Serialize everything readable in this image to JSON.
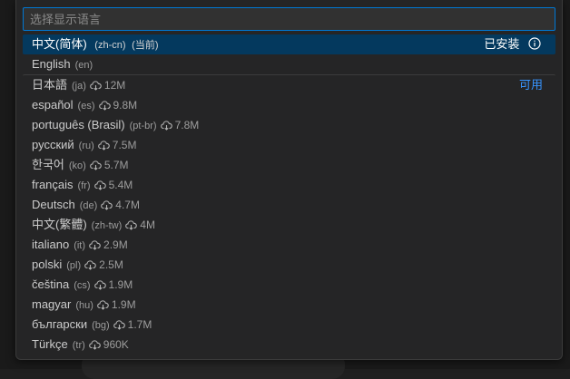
{
  "search": {
    "placeholder": "选择显示语言"
  },
  "selected_language": {
    "name": "中文(简体)",
    "code": "(zh-cn)",
    "tag": "(当前)",
    "status": "已安装",
    "icon": "info-icon"
  },
  "installed_languages": [
    {
      "name": "English",
      "code": "(en)"
    }
  ],
  "available_label": "可用",
  "available_languages": [
    {
      "name": "日本語",
      "code": "(ja)",
      "size": "12M"
    },
    {
      "name": "español",
      "code": "(es)",
      "size": "9.8M"
    },
    {
      "name": "português (Brasil)",
      "code": "(pt-br)",
      "size": "7.8M"
    },
    {
      "name": "русский",
      "code": "(ru)",
      "size": "7.5M"
    },
    {
      "name": "한국어",
      "code": "(ko)",
      "size": "5.7M"
    },
    {
      "name": "français",
      "code": "(fr)",
      "size": "5.4M"
    },
    {
      "name": "Deutsch",
      "code": "(de)",
      "size": "4.7M"
    },
    {
      "name": "中文(繁體)",
      "code": "(zh-tw)",
      "size": "4M"
    },
    {
      "name": "italiano",
      "code": "(it)",
      "size": "2.9M"
    },
    {
      "name": "polski",
      "code": "(pl)",
      "size": "2.5M"
    },
    {
      "name": "čeština",
      "code": "(cs)",
      "size": "1.9M"
    },
    {
      "name": "magyar",
      "code": "(hu)",
      "size": "1.9M"
    },
    {
      "name": "български",
      "code": "(bg)",
      "size": "1.7M"
    },
    {
      "name": "Türkçe",
      "code": "(tr)",
      "size": "960K"
    }
  ],
  "colors": {
    "accent": "#0078d4",
    "selection": "#04395e",
    "link": "#3794ff"
  }
}
